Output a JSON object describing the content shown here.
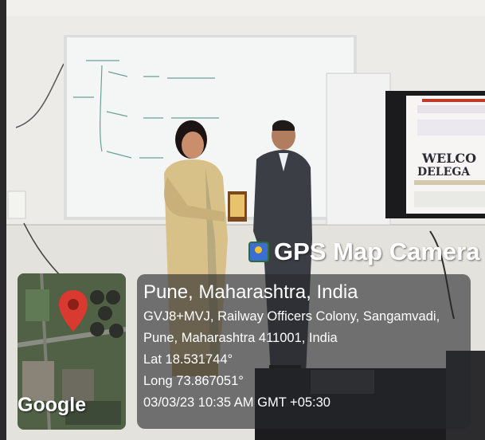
{
  "watermark": {
    "app_name": "GPS Map Camera",
    "city": "Pune, Maharashtra, India",
    "address_line1": "GVJ8+MVJ, Railway Officers Colony, Sangamvadi,",
    "address_line2": "Pune, Maharashtra 411001, India",
    "lat": "Lat 18.531744°",
    "long": "Long 73.867051°",
    "datetime": "03/03/23 10:35 AM GMT +05:30",
    "map_brand": "Google"
  },
  "screen": {
    "line1": "WELCO",
    "line2": "DELEGA"
  },
  "colors": {
    "wall": "#ecebe7",
    "whiteboard": "#f4f6f5",
    "screen_bg": "#f2f2f2",
    "pin": "#d93a2f",
    "overlay": "#26282c"
  }
}
